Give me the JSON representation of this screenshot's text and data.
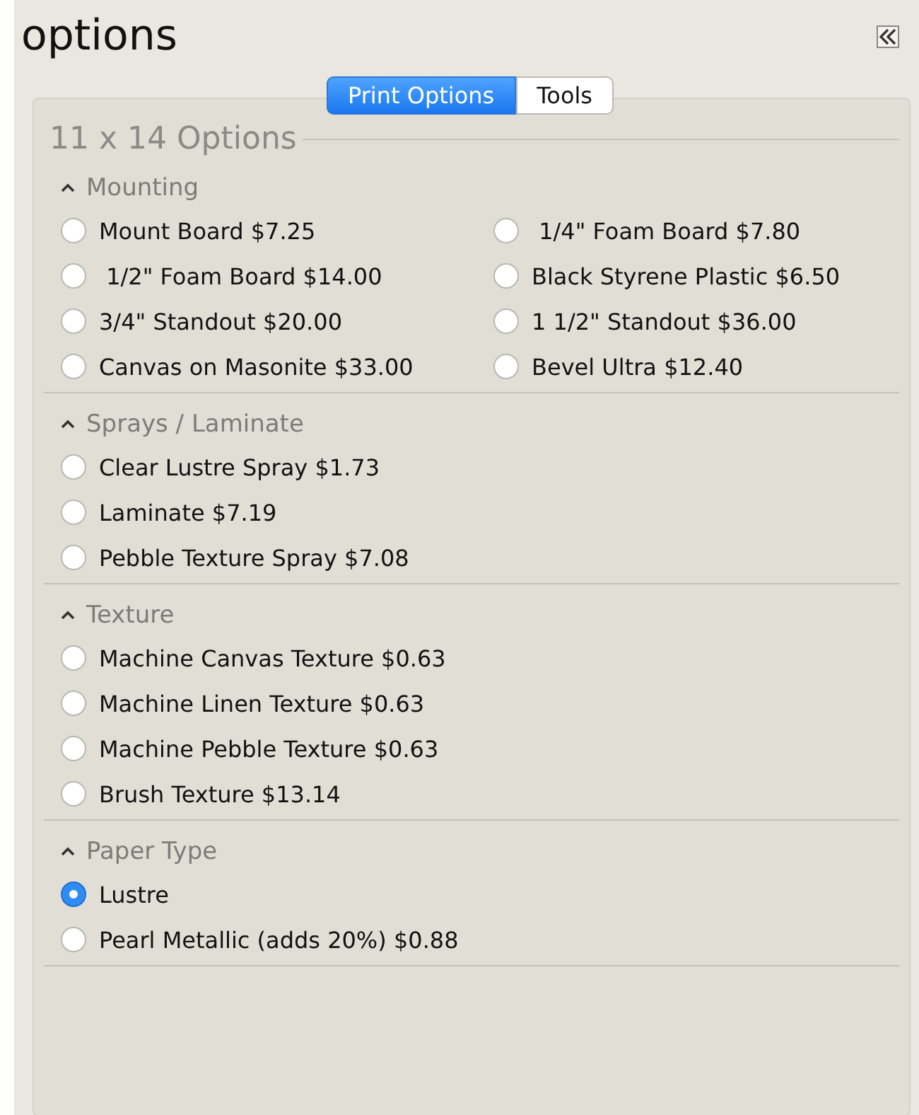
{
  "title": "options",
  "tabs": [
    {
      "label": "Print Options",
      "selected": true
    },
    {
      "label": "Tools",
      "selected": false
    }
  ],
  "group_title": "11 x 14 Options",
  "sections": [
    {
      "title": "Mounting",
      "expanded": true,
      "kind": "grid",
      "options": [
        {
          "label": "Mount Board $7.25",
          "selected": false
        },
        {
          "label": " 1/4\" Foam Board $7.80",
          "selected": false
        },
        {
          "label": " 1/2\" Foam Board $14.00",
          "selected": false
        },
        {
          "label": "Black Styrene Plastic $6.50",
          "selected": false
        },
        {
          "label": "3/4\" Standout $20.00",
          "selected": false
        },
        {
          "label": "1 1/2\" Standout $36.00",
          "selected": false
        },
        {
          "label": "Canvas on Masonite $33.00",
          "selected": false
        },
        {
          "label": "Bevel Ultra $12.40",
          "selected": false
        }
      ]
    },
    {
      "title": "Sprays / Laminate",
      "expanded": true,
      "kind": "list",
      "options": [
        {
          "label": "Clear Lustre Spray $1.73",
          "selected": false
        },
        {
          "label": "Laminate $7.19",
          "selected": false
        },
        {
          "label": "Pebble Texture Spray $7.08",
          "selected": false
        }
      ]
    },
    {
      "title": "Texture",
      "expanded": true,
      "kind": "list",
      "options": [
        {
          "label": "Machine Canvas Texture $0.63",
          "selected": false
        },
        {
          "label": "Machine Linen Texture $0.63",
          "selected": false
        },
        {
          "label": "Machine Pebble Texture $0.63",
          "selected": false
        },
        {
          "label": "Brush Texture $13.14",
          "selected": false
        }
      ]
    },
    {
      "title": "Paper Type",
      "expanded": true,
      "kind": "list",
      "options": [
        {
          "label": "Lustre",
          "selected": true
        },
        {
          "label": "Pearl Metallic (adds 20%) $0.88",
          "selected": false
        }
      ]
    }
  ]
}
